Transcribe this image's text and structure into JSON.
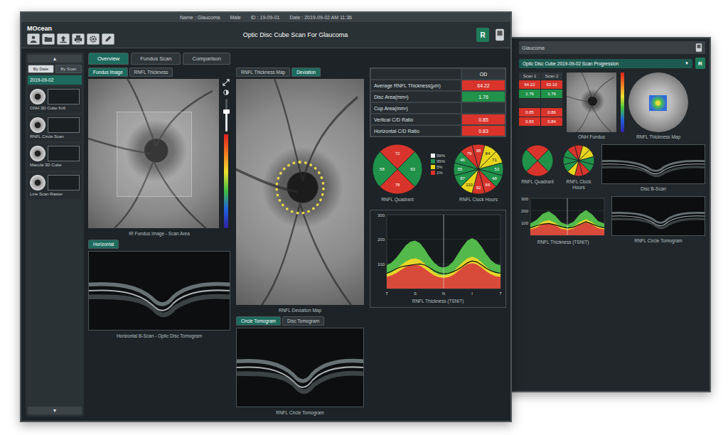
{
  "front": {
    "patient_bar": [
      "Name : Glaucoma",
      "Male",
      "ID : 19-09-01",
      "Date : 2019-09-02 AM 11:36"
    ],
    "logo": "MOcean",
    "title": "Optic Disc Cube Scan For Glaucoma",
    "eye_badge": "R",
    "sidebar": {
      "up": "▲",
      "down": "▼",
      "tabs": [
        {
          "label": "By Date",
          "selected": true
        },
        {
          "label": "By Scan",
          "selected": false
        }
      ],
      "session": {
        "label": "2019-09-02",
        "selected": true
      },
      "items": [
        {
          "label": "ONH 3D Cube 6x6",
          "selected": false
        },
        {
          "label": "RNFL Circle Scan",
          "selected": false
        },
        {
          "label": "Macula 3D Cube",
          "selected": false
        },
        {
          "label": "Line Scan Raster",
          "selected": false
        }
      ]
    },
    "tabs": [
      {
        "label": "Overview",
        "selected": true
      },
      {
        "label": "Fundus Scan",
        "selected": false
      },
      {
        "label": "Comparison",
        "selected": false
      }
    ],
    "fundus_panel": {
      "tabs": [
        {
          "label": "Fundus Image",
          "selected": true
        },
        {
          "label": "RNFL Thickness",
          "selected": false
        }
      ],
      "caption": "IR Fundus Image - Scan Area",
      "brightness": {
        "level": 0.6
      }
    },
    "bscan_panel": {
      "tabs": [
        {
          "label": "Horizontal",
          "selected": true
        }
      ],
      "caption": "Horizontal B-Scan - Optic Disc Tomogram"
    },
    "deviation_panel": {
      "tabs": [
        {
          "label": "RNFL Thickness Map",
          "selected": false
        },
        {
          "label": "Deviation",
          "selected": true
        }
      ],
      "caption": "RNFL Deviation Map"
    },
    "circle_panel": {
      "tabs": [
        {
          "label": "Circle Tomogram",
          "selected": true
        },
        {
          "label": "Disc Tomogram",
          "selected": false
        }
      ],
      "caption": "RNFL Circle Tomogram"
    },
    "table": {
      "column": "OD",
      "rows": [
        {
          "label": "Average RNFL Thickness(μm)",
          "value": "64.22",
          "status": "outside"
        },
        {
          "label": "Disc Area(mm²)",
          "value": "1.76",
          "status": "normal"
        },
        {
          "label": "Cup Area(mm²)",
          "value": "",
          "status": "none"
        },
        {
          "label": "Vertical C/D Ratio",
          "value": "0.85",
          "status": "outside"
        },
        {
          "label": "Horizontal C/D Ratio",
          "value": "0.83",
          "status": "outside"
        }
      ]
    },
    "legend": [
      {
        "status": "above",
        "label": "99%"
      },
      {
        "status": "normal",
        "label": "95%"
      },
      {
        "status": "borderline",
        "label": "5%"
      },
      {
        "status": "outside",
        "label": "1%"
      }
    ],
    "quadrant": {
      "caption": "RNFL Quadrant",
      "sectors": [
        {
          "value": "72",
          "status": "outside"
        },
        {
          "value": "63",
          "status": "normal"
        },
        {
          "value": "78",
          "status": "outside"
        },
        {
          "value": "58",
          "status": "normal"
        }
      ]
    },
    "clock": {
      "caption": "RNFL Clock Hours",
      "sectors": [
        {
          "value": "98",
          "status": "outside"
        },
        {
          "value": "84",
          "status": "borderline"
        },
        {
          "value": "71",
          "status": "borderline"
        },
        {
          "value": "52",
          "status": "normal"
        },
        {
          "value": "48",
          "status": "normal"
        },
        {
          "value": "66",
          "status": "outside"
        },
        {
          "value": "92",
          "status": "outside"
        },
        {
          "value": "110",
          "status": "borderline"
        },
        {
          "value": "87",
          "status": "normal"
        },
        {
          "value": "55",
          "status": "normal"
        },
        {
          "value": "46",
          "status": "normal"
        },
        {
          "value": "79",
          "status": "outside"
        }
      ]
    },
    "chart": {
      "caption": "RNFL Thickness (TSNIT)",
      "y_ticks": [
        "300",
        "200",
        "100"
      ],
      "x_ticks": [
        "T",
        "S",
        "N",
        "I",
        "T"
      ],
      "normal_95": [
        95,
        105,
        125,
        150,
        175,
        190,
        195,
        185,
        160,
        130,
        105,
        90,
        85,
        92,
        110,
        140,
        170,
        195,
        205,
        195,
        170,
        140,
        115,
        100,
        95
      ],
      "normal_5": [
        60,
        66,
        79,
        95,
        110,
        120,
        123,
        117,
        101,
        82,
        66,
        57,
        54,
        58,
        69,
        88,
        107,
        123,
        129,
        123,
        107,
        88,
        72,
        63,
        60
      ],
      "normal_1": [
        48,
        53,
        63,
        76,
        88,
        96,
        98,
        93,
        81,
        66,
        53,
        46,
        43,
        46,
        55,
        70,
        86,
        98,
        103,
        98,
        86,
        70,
        58,
        50,
        48
      ],
      "measured": [
        62,
        70,
        80,
        88,
        92,
        95,
        98,
        100,
        96,
        85,
        72,
        64,
        60,
        62,
        68,
        78,
        90,
        104,
        112,
        108,
        96,
        82,
        72,
        66,
        62
      ]
    }
  },
  "back": {
    "title": "Glaucoma",
    "eye_badge": "R",
    "dropdown": {
      "value": "Optic Disc Cube 2019-09-02 Scan Progression",
      "arrow": "▼"
    },
    "table": {
      "columns": [
        "Scan 1",
        "Scan 2"
      ],
      "rows": [
        {
          "cells": [
            {
              "value": "64.22",
              "status": "outside"
            },
            {
              "value": "63.10",
              "status": "outside"
            }
          ]
        },
        {
          "cells": [
            {
              "value": "1.76",
              "status": "normal"
            },
            {
              "value": "1.76",
              "status": "normal"
            }
          ]
        },
        {
          "cells": [
            {
              "value": "",
              "status": "none"
            },
            {
              "value": "",
              "status": "none"
            }
          ]
        },
        {
          "cells": [
            {
              "value": "0.85",
              "status": "outside"
            },
            {
              "value": "0.86",
              "status": "outside"
            }
          ]
        },
        {
          "cells": [
            {
              "value": "0.83",
              "status": "outside"
            },
            {
              "value": "0.84",
              "status": "outside"
            }
          ]
        }
      ]
    },
    "fundus_caption": "ONH Fundus",
    "map_caption": "RNFL Thickness Map",
    "quadrant": {
      "caption": "RNFL Quadrant",
      "sectors": [
        {
          "status": "outside"
        },
        {
          "status": "normal"
        },
        {
          "status": "outside"
        },
        {
          "status": "normal"
        }
      ]
    },
    "clock": {
      "caption": "RNFL Clock Hours",
      "sectors": [
        {
          "status": "outside"
        },
        {
          "status": "borderline"
        },
        {
          "status": "borderline"
        },
        {
          "status": "normal"
        },
        {
          "status": "normal"
        },
        {
          "status": "outside"
        },
        {
          "status": "outside"
        },
        {
          "status": "borderline"
        },
        {
          "status": "normal"
        },
        {
          "status": "normal"
        },
        {
          "status": "normal"
        },
        {
          "status": "outside"
        }
      ]
    },
    "chart": {
      "caption": "RNFL Thickness (TSNIT)",
      "y_ticks": [
        "300",
        "200",
        "100"
      ],
      "normal_95": [
        95,
        125,
        175,
        195,
        160,
        105,
        85,
        110,
        170,
        205,
        170,
        115,
        95
      ],
      "normal_5": [
        60,
        79,
        110,
        123,
        101,
        66,
        54,
        69,
        107,
        129,
        107,
        72,
        60
      ],
      "normal_1": [
        48,
        63,
        88,
        98,
        81,
        53,
        43,
        55,
        86,
        103,
        86,
        58,
        48
      ],
      "measured": [
        60,
        78,
        90,
        96,
        84,
        70,
        58,
        66,
        88,
        110,
        92,
        72,
        60
      ]
    },
    "bscans": [
      {
        "caption": "Disc B-Scan"
      },
      {
        "caption": "RNFL Circle Tomogram"
      }
    ]
  }
}
